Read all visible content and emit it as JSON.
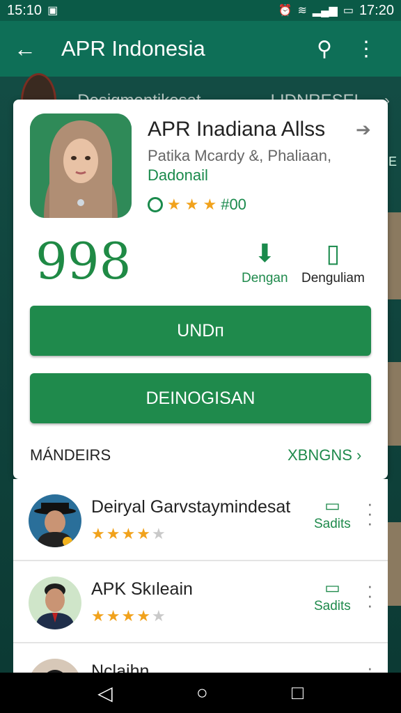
{
  "status_bar": {
    "left_time": "15:10",
    "right_time": "17:20"
  },
  "app_bar": {
    "title": "APR Indonesia",
    "back_icon": "back-arrow-icon",
    "search_icon": "search-icon",
    "more_icon": "overflow-menu-icon"
  },
  "background_row": {
    "left_text": "Desigmentikesat",
    "right_text": "LIDNRESEL",
    "chevron": "›",
    "edge_letter": "E"
  },
  "app_card": {
    "name": "APR Inadiana Allss",
    "developer_line1": "Patika Mcardy &, Phaliaan,",
    "developer_line2": "Dadonail",
    "rating_text": "#00",
    "rating_stars": 3,
    "big_number": "998",
    "stat1_label": "Dengan",
    "stat2_label": "Denguliam",
    "primary_button": "UNDᴨ",
    "secondary_button": "DEINOGISAN",
    "section_label": "MÁNDEIRS",
    "section_link": "XBNGNS"
  },
  "reviews": [
    {
      "name": "Deiryal Garvstaymindesat",
      "rating": 4,
      "action_label": "Sadits"
    },
    {
      "name": "APK Skıleain",
      "rating": 3.5,
      "action_label": "Sadits"
    },
    {
      "name": "Nclaihn",
      "rating": 0,
      "action_label": ""
    }
  ],
  "nav_bar": {
    "back": "◁",
    "home": "○",
    "recents": "□"
  },
  "colors": {
    "primary": "#1f8a4c",
    "app_bar": "#0e6f57",
    "status_bar": "#0b5a47"
  }
}
